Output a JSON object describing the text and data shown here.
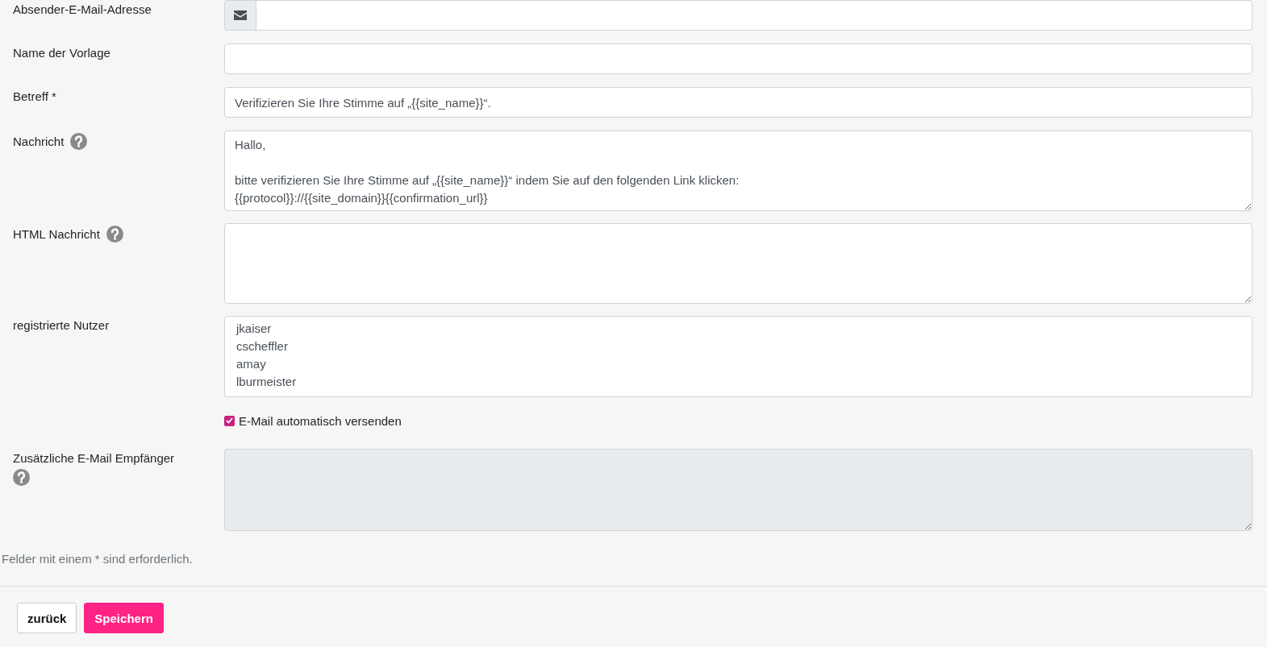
{
  "fields": [
    {
      "kind": "email",
      "label": "Absender-E-Mail-Adresse"
    },
    {
      "kind": "text",
      "label": "Name der Vorlage"
    },
    {
      "kind": "text",
      "label": "Betreff *",
      "value": "Verifizieren Sie Ihre Stimme auf „{{site_name}}“."
    },
    {
      "kind": "textarea",
      "label": "Nachricht",
      "help": true,
      "value": "Hallo,\n\nbitte verifizieren Sie Ihre Stimme auf „{{site_name}}“ indem Sie auf den folgenden Link klicken:\n{{protocol}}://{{site_domain}}{{confirmation_url}}"
    },
    {
      "kind": "textarea",
      "label": "HTML Nachricht",
      "help": true
    },
    {
      "kind": "multiselect",
      "label": "registrierte Nutzer",
      "options": [
        {
          "label": "jkaiser",
          "selected": false
        },
        {
          "label": "cscheffler",
          "selected": false
        },
        {
          "label": "amay",
          "selected": false
        },
        {
          "label": "lburmeister",
          "selected": false
        }
      ]
    },
    {
      "kind": "checkbox",
      "label": "E-Mail automatisch versenden",
      "checked": true
    },
    {
      "kind": "textarea",
      "label": "Zusätzliche E-Mail Empfänger",
      "help": true,
      "disabled": true
    }
  ],
  "note": "Felder mit einem * sind erforderlich.",
  "buttons": [
    {
      "label": "zurück",
      "kind": "secondary"
    },
    {
      "label": "Speichern",
      "kind": "primary"
    }
  ]
}
